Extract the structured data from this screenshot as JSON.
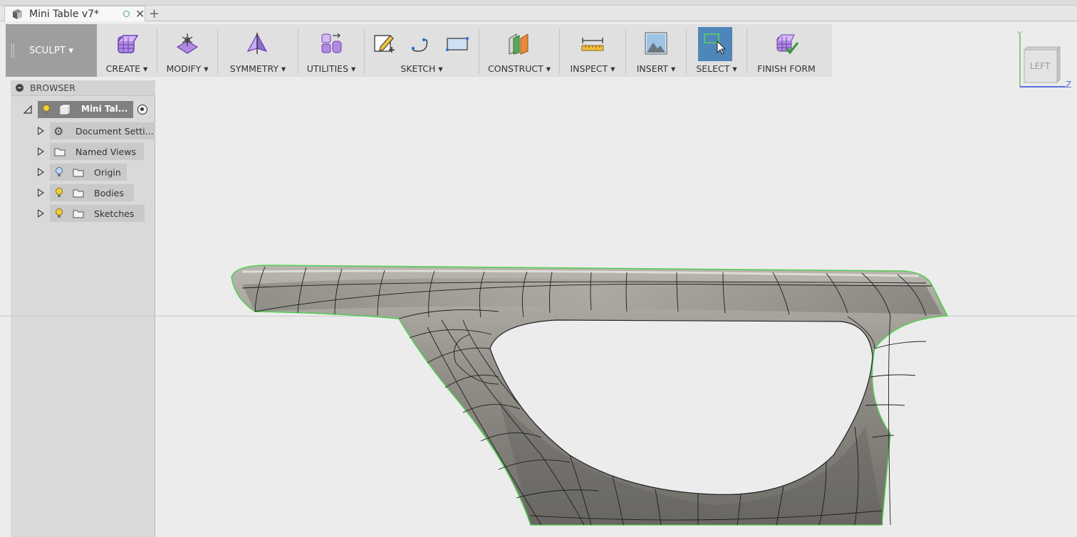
{
  "document": {
    "tab_title": "Mini Table v7*",
    "new_tab_symbol": "+"
  },
  "toolbar": {
    "workspace": "SCULPT ▾",
    "groups": [
      {
        "label": "CREATE ▾"
      },
      {
        "label": "MODIFY ▾"
      },
      {
        "label": "SYMMETRY ▾"
      },
      {
        "label": "UTILITIES ▾"
      },
      {
        "label": "SKETCH ▾"
      },
      {
        "label": "CONSTRUCT ▾"
      },
      {
        "label": "INSPECT ▾"
      },
      {
        "label": "INSERT ▾"
      },
      {
        "label": "SELECT ▾"
      },
      {
        "label": "FINISH FORM"
      }
    ]
  },
  "browser": {
    "title": "BROWSER",
    "root": "Mini Tal...",
    "items": [
      {
        "label": "Document Setti..."
      },
      {
        "label": "Named Views"
      },
      {
        "label": "Origin"
      },
      {
        "label": "Bodies"
      },
      {
        "label": "Sketches"
      }
    ]
  },
  "viewcube": {
    "face": "LEFT",
    "axis_y": "Y",
    "axis_z": "Z"
  },
  "colors": {
    "accent": "#4f86b9",
    "toolbar": "#e0e0e0",
    "workspace": "#9e9e9e",
    "viewport": "#ececec",
    "model": "#9a9891"
  }
}
